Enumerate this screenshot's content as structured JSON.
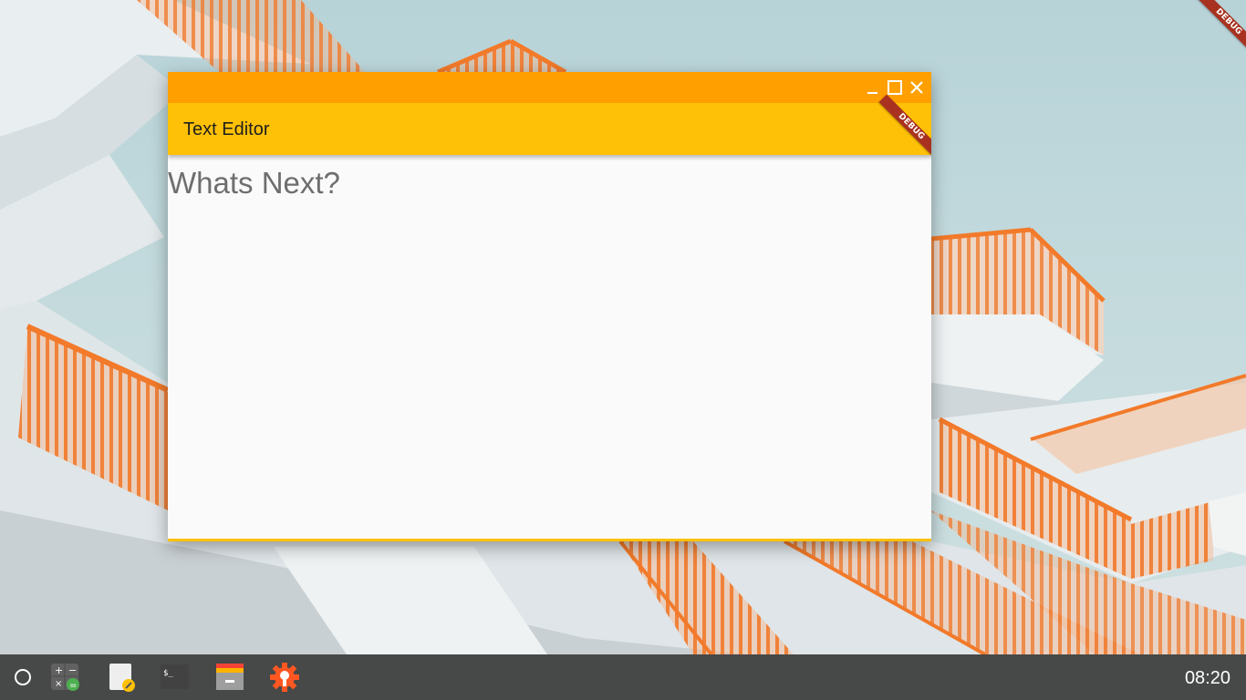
{
  "window": {
    "title": "Text Editor",
    "editor_placeholder": "Whats Next?",
    "controls": {
      "minimize_icon": "minimize-icon",
      "maximize_icon": "maximize-icon",
      "close_icon": "close-icon"
    },
    "debug_banner": "DEBUG"
  },
  "screen_debug_banner": "DEBUG",
  "taskbar": {
    "launcher_icon": "circle-launcher-icon",
    "apps": [
      {
        "name": "calculator",
        "icon": "calculator-icon"
      },
      {
        "name": "text-editor",
        "icon": "text-editor-icon"
      },
      {
        "name": "terminal",
        "icon": "terminal-icon",
        "glyph": "$_"
      },
      {
        "name": "files",
        "icon": "archive-icon"
      },
      {
        "name": "settings",
        "icon": "settings-gear-icon"
      }
    ],
    "clock": "08:20"
  },
  "colors": {
    "titlebar": "#ffa000",
    "appbar": "#ffc107",
    "editor_bg": "#fafafa",
    "taskbar": "#3c3c3c",
    "debug_ribbon": "#a8321f"
  }
}
